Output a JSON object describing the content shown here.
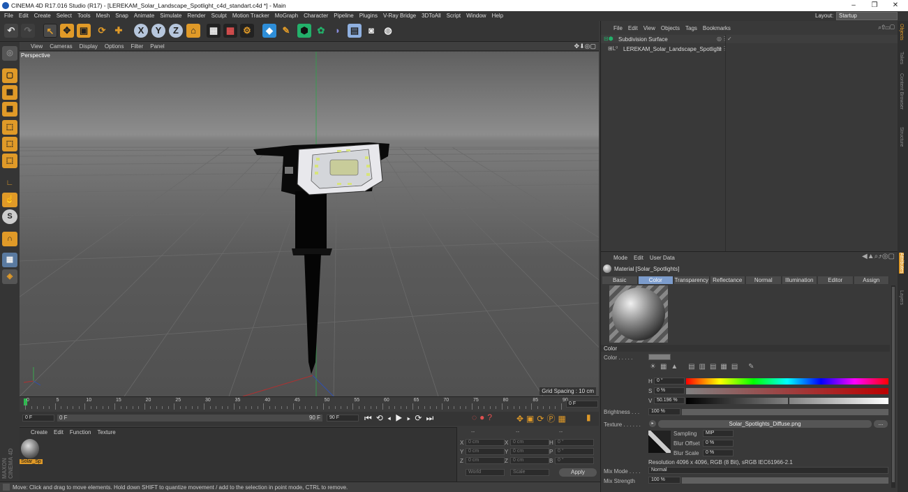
{
  "window": {
    "title": "CINEMA 4D R17.016 Studio (R17) - [LEREKAM_Solar_Landscape_Spotlight_c4d_standart.c4d *] - Main",
    "minimize": "–",
    "restore": "❐",
    "close": "✕"
  },
  "menu": [
    "File",
    "Edit",
    "Create",
    "Select",
    "Tools",
    "Mesh",
    "Snap",
    "Animate",
    "Simulate",
    "Render",
    "Sculpt",
    "Motion Tracker",
    "MoGraph",
    "Character",
    "Pipeline",
    "Plugins",
    "V-Ray Bridge",
    "3DToAll",
    "Script",
    "Window",
    "Help"
  ],
  "layout": {
    "label": "Layout:",
    "value": "Startup"
  },
  "viewport": {
    "menu": [
      "View",
      "Cameras",
      "Display",
      "Options",
      "Filter",
      "Panel"
    ],
    "label": "Perspective",
    "grid_spacing": "Grid Spacing : 10 cm"
  },
  "timeline": {
    "ticks": [
      "0",
      "5",
      "10",
      "15",
      "20",
      "25",
      "30",
      "35",
      "40",
      "45",
      "50",
      "55",
      "60",
      "65",
      "70",
      "75",
      "80",
      "85",
      "90"
    ],
    "frame_display": "0 F",
    "start": "0 F",
    "current": "0 F",
    "end": "90 F",
    "end2": "90 F"
  },
  "material_manager": {
    "menu": [
      "Create",
      "Edit",
      "Function",
      "Texture"
    ],
    "material_name": "Solar_Sp"
  },
  "coords": {
    "header": [
      "--",
      "--",
      "--"
    ],
    "rows": [
      {
        "a": "X",
        "av": "0 cm",
        "b": "X",
        "bv": "0 cm",
        "c": "H",
        "cv": "0 °"
      },
      {
        "a": "Y",
        "av": "0 cm",
        "b": "Y",
        "bv": "0 cm",
        "c": "P",
        "cv": "0 °"
      },
      {
        "a": "Z",
        "av": "0 cm",
        "b": "Z",
        "bv": "0 cm",
        "c": "B",
        "cv": "0 °"
      }
    ],
    "mode1": "World",
    "mode2": "Scale",
    "apply": "Apply"
  },
  "status": "Move: Click and drag to move elements. Hold down SHIFT to quantize movement / add to the selection in point mode, CTRL to remove.",
  "objects": {
    "menu": [
      "File",
      "Edit",
      "View",
      "Objects",
      "Tags",
      "Bookmarks"
    ],
    "items": [
      {
        "name": "Subdivision Surface"
      },
      {
        "name": "LEREKAM_Solar_Landscape_Spotlight"
      }
    ]
  },
  "attributes": {
    "menu": [
      "Mode",
      "Edit",
      "User Data"
    ],
    "material_title": "Material [Solar_Spotlights]",
    "tabs": [
      "Basic",
      "Color",
      "Transparency",
      "Reflectance",
      "Normal",
      "Illumination",
      "Editor",
      "Assign"
    ],
    "active_tab": "Color",
    "section": "Color",
    "color_label": "Color . . . . .",
    "h_label": "H",
    "h_value": "0 °",
    "s_label": "S",
    "s_value": "0 %",
    "v_label": "V",
    "v_value": "50.196 %",
    "v_fraction": 0.50196,
    "brightness_label": "Brightness . . .",
    "brightness_value": "100 %",
    "texture_label": "Texture . . . . . .",
    "texture_file": "Solar_Spotlights_Diffuse.png",
    "texture_more": "...",
    "sampling_label": "Sampling",
    "sampling_value": "MIP",
    "blur_offset_label": "Blur Offset",
    "blur_offset_value": "0 %",
    "blur_scale_label": "Blur Scale",
    "blur_scale_value": "0 %",
    "resolution": "Resolution 4096 x 4096, RGB (8 Bit), sRGB IEC61966-2.1",
    "mix_mode_label": "Mix Mode . . . .",
    "mix_mode_value": "Normal",
    "mix_strength_label": "Mix Strength",
    "mix_strength_value": "100 %"
  },
  "side_tabs": [
    "Objects",
    "Takes",
    "Content Browser",
    "Structure"
  ],
  "side_tabs2": [
    "Attributes",
    "Layers"
  ],
  "brand": [
    "MAXON",
    "CINEMA 4D"
  ],
  "colors": {
    "accent": "#7c9ccc",
    "bg": "#3a3a3a",
    "active_frame": "#2dbb4f"
  }
}
